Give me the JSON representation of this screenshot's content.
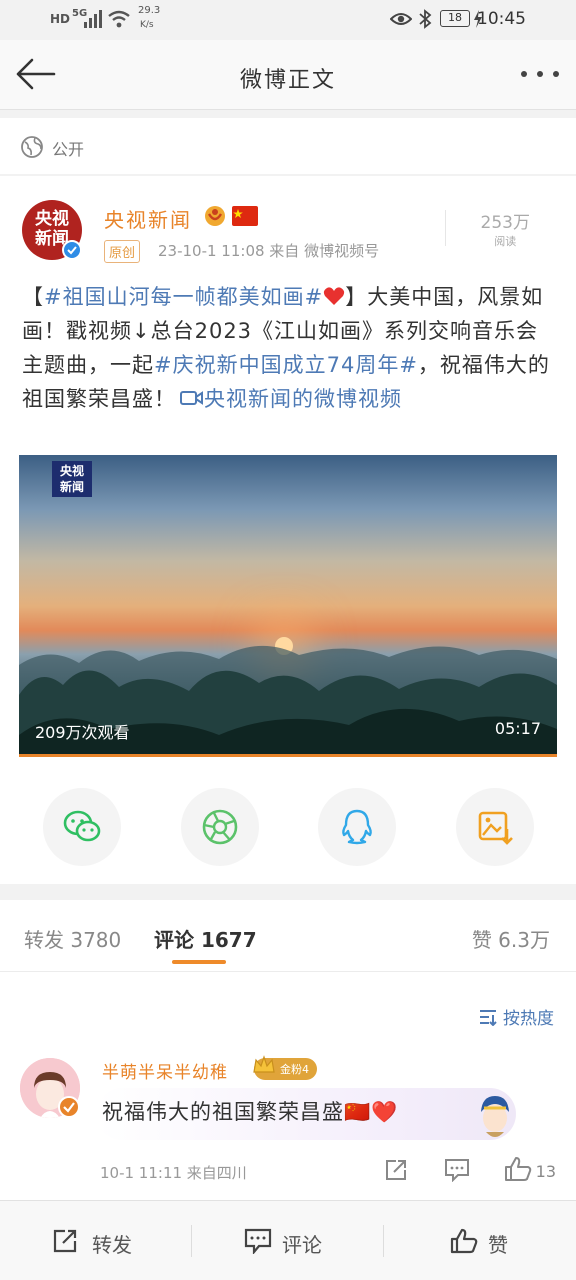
{
  "status_bar": {
    "network": "HD",
    "signal": "5G",
    "speed_value": "29.3",
    "speed_unit": "K/s",
    "battery": "18",
    "time": "10:45"
  },
  "nav": {
    "title": "微博正文"
  },
  "visibility": {
    "label": "公开"
  },
  "post": {
    "avatar_line1": "央视",
    "avatar_line2": "新闻",
    "author": "央视新闻",
    "original_tag": "原创",
    "meta": "23-10-1 11:08  来自 微博视频号",
    "reads_value": "253万",
    "reads_label": "阅读",
    "text_part1": "【",
    "hashtag1": "#祖国山河每一帧都美如画#",
    "text_part2": "】大美中国，风景如画！戳视频↓总台2023《江山如画》系列交响音乐会主题曲，一起",
    "hashtag2": "#庆祝新中国成立74周年#",
    "text_part3": "，祝福伟大的祖国繁荣昌盛！",
    "video_link": "央视新闻的微博视频",
    "video": {
      "logo_line1": "央视",
      "logo_line2": "新闻",
      "views": "209万次观看",
      "duration": "05:17",
      "progress": 1.0
    }
  },
  "share_icons": [
    "wechat-icon",
    "moments-icon",
    "qq-icon",
    "save-image-icon"
  ],
  "tabs": {
    "repost": "转发 3780",
    "comments": "评论 1677",
    "likes": "赞 6.3万"
  },
  "comments": {
    "sort_label": "按热度",
    "items": [
      {
        "user": "半萌半呆半幼稚",
        "fan_badge": "金粉4",
        "text": "祝福伟大的祖国繁荣昌盛🇨🇳❤️",
        "meta": "10-1 11:11  来自四川",
        "likes": "13"
      }
    ]
  },
  "bottom_bar": {
    "repost": "转发",
    "comment": "评论",
    "like": "赞"
  },
  "colors": {
    "accent": "#e8842a",
    "link": "#4e7ab5"
  }
}
